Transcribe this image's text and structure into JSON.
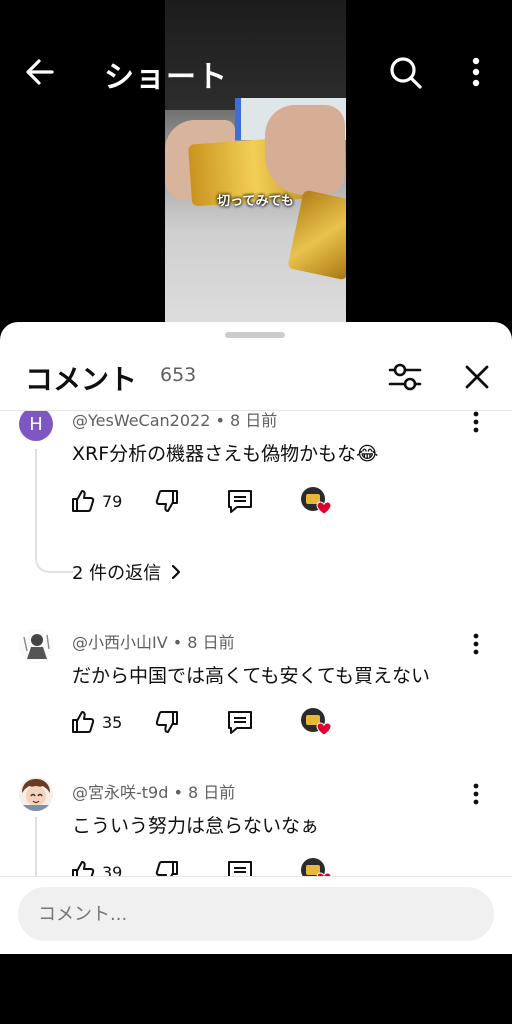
{
  "header": {
    "title": "ショート",
    "back_icon": "arrow-left-icon",
    "search_icon": "search-icon",
    "more_icon": "more-vert-icon"
  },
  "video": {
    "caption": "切ってみても"
  },
  "comments_panel": {
    "title": "コメント",
    "count": "653",
    "comments": [
      {
        "avatar_letter": "H",
        "avatar_color": "#7e57c2",
        "author": "@YesWeCan2022",
        "age": "8 日前",
        "text": "XRF分析の機器さえも偽物かもな😂",
        "likes": "79",
        "replies": "2 件の返信"
      },
      {
        "author": "@小西小山IV",
        "age": "8 日前",
        "text": "だから中国では高くても安くても買えない",
        "likes": "35"
      },
      {
        "author": "@宮永咲-t9d",
        "age": "8 日前",
        "text": "こういう努力は怠らないなぁ",
        "likes": "39"
      }
    ],
    "separator": "•"
  },
  "input": {
    "placeholder": "コメント..."
  }
}
